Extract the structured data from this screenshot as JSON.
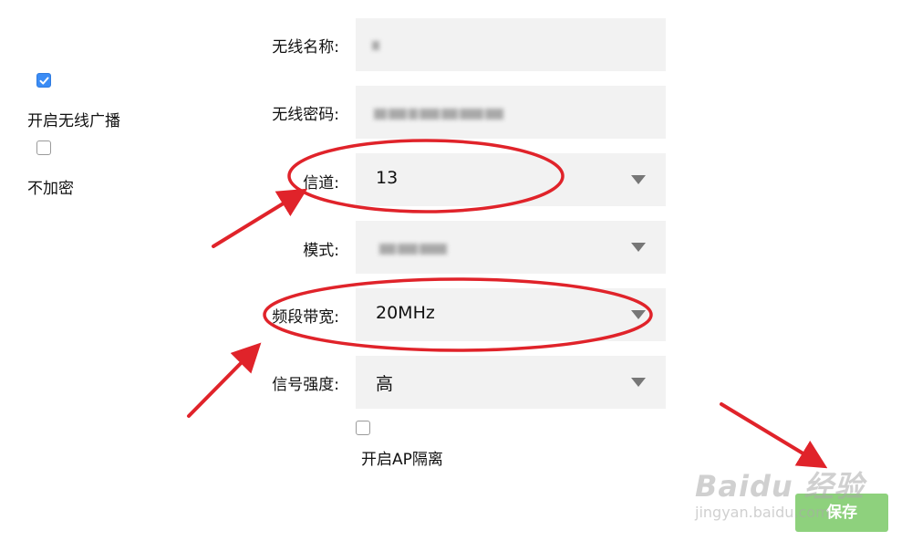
{
  "left_options": [
    {
      "label": "开启无线广播",
      "checked": true
    },
    {
      "label": "不加密",
      "checked": false
    }
  ],
  "form": {
    "ssid_label": "无线名称:",
    "password_label": "无线密码:",
    "channel_label": "信道:",
    "channel_value": "13",
    "mode_label": "模式:",
    "bandwidth_label": "频段带宽:",
    "bandwidth_value": "20MHz",
    "signal_label": "信号强度:",
    "signal_value": "高",
    "ap_isolation_label": "开启AP隔离",
    "ap_isolation_checked": false
  },
  "save_label": "保存",
  "watermark": {
    "top": "Baidu 经验",
    "bottom": "jingyan.baidu.com"
  },
  "colors": {
    "annotation_red": "#e0232a",
    "checkbox_blue": "#3b8cf5",
    "save_green": "#8ed17d",
    "field_bg": "#f2f2f2"
  }
}
